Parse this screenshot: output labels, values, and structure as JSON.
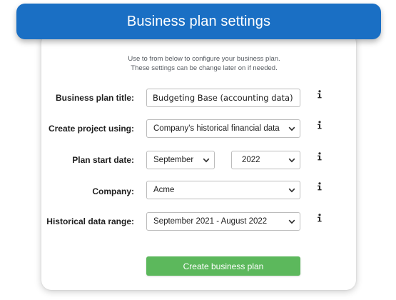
{
  "header": {
    "title": "Business plan settings"
  },
  "intro": "Use to from below to configure your business plan. These settings can be change later on if needed.",
  "form": {
    "title": {
      "label": "Business plan title:",
      "value": "Budgeting Base (accounting data)"
    },
    "create_using": {
      "label": "Create project using:",
      "value": "Company's historical financial data"
    },
    "start_date": {
      "label": "Plan start date:",
      "month": "September",
      "year": "2022"
    },
    "company": {
      "label": "Company:",
      "value": "Acme"
    },
    "historical_range": {
      "label": "Historical data range:",
      "value": "September 2021 - August 2022"
    }
  },
  "actions": {
    "create_label": "Create business plan"
  },
  "colors": {
    "header_bg": "#1a6fc4",
    "button_bg": "#5cb85c"
  },
  "icons": {
    "info": "info-icon",
    "dropdown": "chevron-down-icon"
  }
}
